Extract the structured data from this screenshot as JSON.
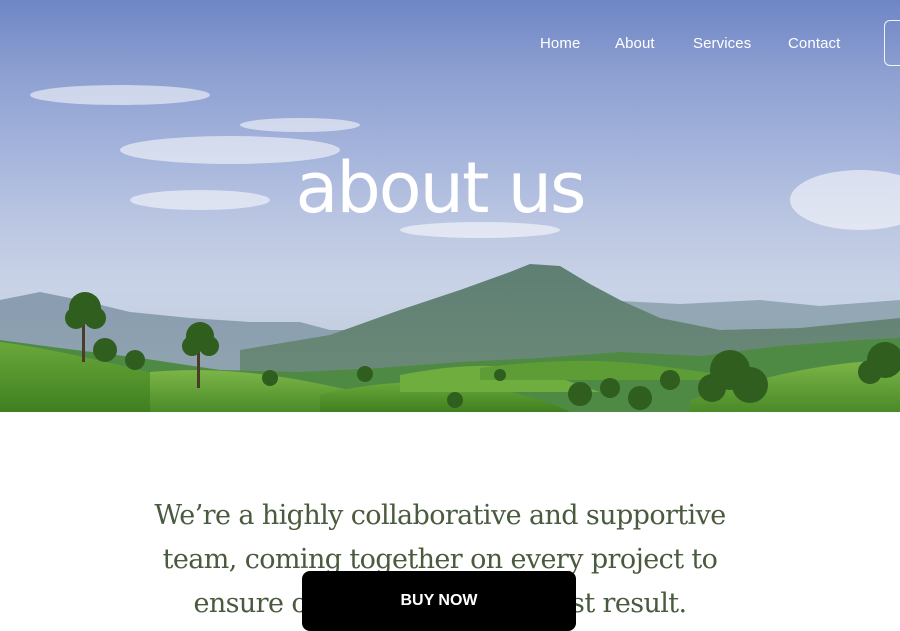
{
  "nav": {
    "items": [
      {
        "label": "Home"
      },
      {
        "label": "About"
      },
      {
        "label": "Services"
      },
      {
        "label": "Contact"
      }
    ]
  },
  "hero": {
    "title": "about us"
  },
  "intro": {
    "text": "We’re a highly collaborative and supportive team, coming together on every project to ensure our clients get the best result."
  },
  "cta": {
    "buy_now_label": "BUY NOW"
  },
  "colors": {
    "sky_top": "#6f86c6",
    "sky_bottom": "#c9d3e7",
    "hills_green": "#5a9a2e",
    "intro_text": "#4a5a3e",
    "buy_button": "#000000"
  }
}
